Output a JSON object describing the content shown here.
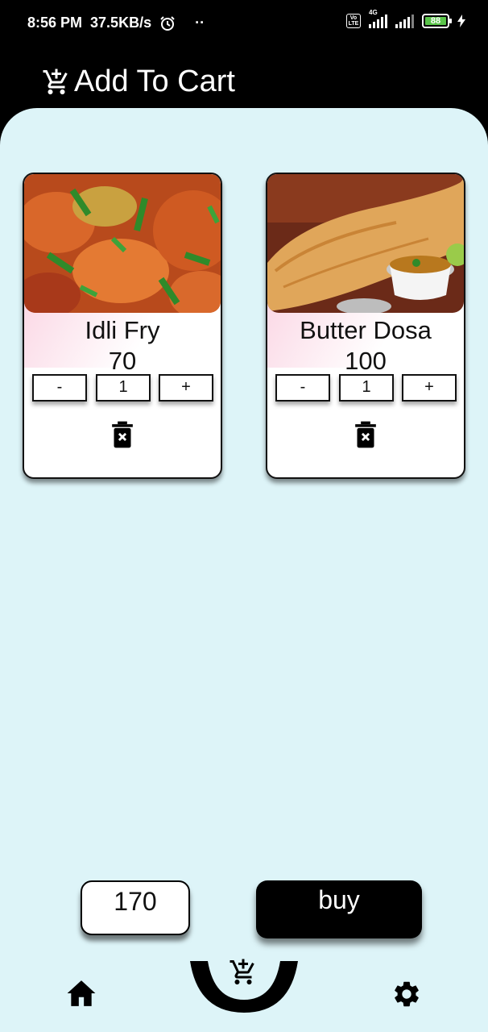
{
  "status_bar": {
    "time": "8:56 PM",
    "speed": "37.5KB/s",
    "dots": "··",
    "volte": "Vo LTE",
    "network": "4G",
    "battery": "88"
  },
  "header": {
    "title": "Add To Cart",
    "icon": "cart-plus-icon"
  },
  "cart": {
    "items": [
      {
        "name": "Idli Fry",
        "price": "70",
        "minus": "-",
        "qty": "1",
        "plus": "+"
      },
      {
        "name": "Butter Dosa",
        "price": "100",
        "minus": "-",
        "qty": "1",
        "plus": "+"
      }
    ]
  },
  "footer": {
    "total": "170",
    "buy_label": "buy"
  },
  "nav": {
    "home_icon": "home-icon",
    "cart_icon": "cart-plus-icon",
    "settings_icon": "gear-icon"
  },
  "colors": {
    "panel_bg": "#ddf4f8",
    "header_bg": "#000000",
    "card_accent": "#fbd9e6"
  }
}
